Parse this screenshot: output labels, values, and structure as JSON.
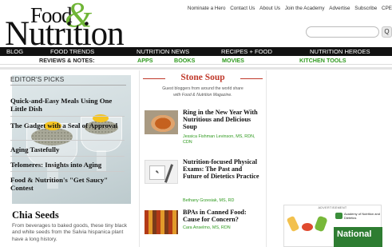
{
  "logo": {
    "food": "Food",
    "amp": "&",
    "nutrition": "Nutrition"
  },
  "top_links": [
    "Nominate a Hero",
    "Contact Us",
    "About Us",
    "Join the Academy",
    "Advertise",
    "Subscribe",
    "CPE"
  ],
  "search": {
    "placeholder": "",
    "button_label": "Q"
  },
  "nav": [
    "BLOG",
    "FOOD TRENDS",
    "NUTRITION NEWS",
    "RECIPES + FOOD",
    "NUTRITION HEROES"
  ],
  "subnav": {
    "label": "REVIEWS & NOTES:",
    "links": [
      "APPS",
      "BOOKS",
      "MOVIES",
      "KITCHEN TOOLS"
    ]
  },
  "feature": {
    "title": "Chia Seeds",
    "text": "From beverages to baked goods, these tiny black and white seeds from the Salvia hispanica plant have a long history."
  },
  "stone_soup": {
    "title": "Stone Soup",
    "subtitle": "Guest bloggers from around the world share",
    "subtitle2": "with Food & Nutrition Magazine.",
    "articles": [
      {
        "title": "Ring in the New Year With Nutritious and Delicious Soup",
        "author": "Jessica Fishman Levinson, MS, RDN, CDN"
      },
      {
        "title": "Nutrition-focused Physical Exams: The Past and Future of Dietetics Practice",
        "author": "Bethany Grzesiak, MS, RD"
      },
      {
        "title": "BPAs in Canned Food: Cause for Concern?",
        "author": "Cara Anselmo, MS, RDN"
      }
    ]
  },
  "editors_picks": {
    "heading": "EDITOR'S PICKS",
    "items": [
      "Quick-and-Easy Meals Using One Little Dish",
      "The Gadget with a Seal of Approval",
      "Aging Tastefully",
      "Telomeres: Insights into Aging",
      "Food & Nutrition's \"Get Saucy\" Contest"
    ]
  },
  "ad": {
    "label": "ADVERTISEMENT",
    "org": "Academy of Nutrition and Dietetics",
    "headline": "National"
  },
  "colors": {
    "brand_green": "#6fb536",
    "link_green": "#2f9a1f",
    "stone_red": "#c0392b",
    "nav_black": "#111111"
  }
}
